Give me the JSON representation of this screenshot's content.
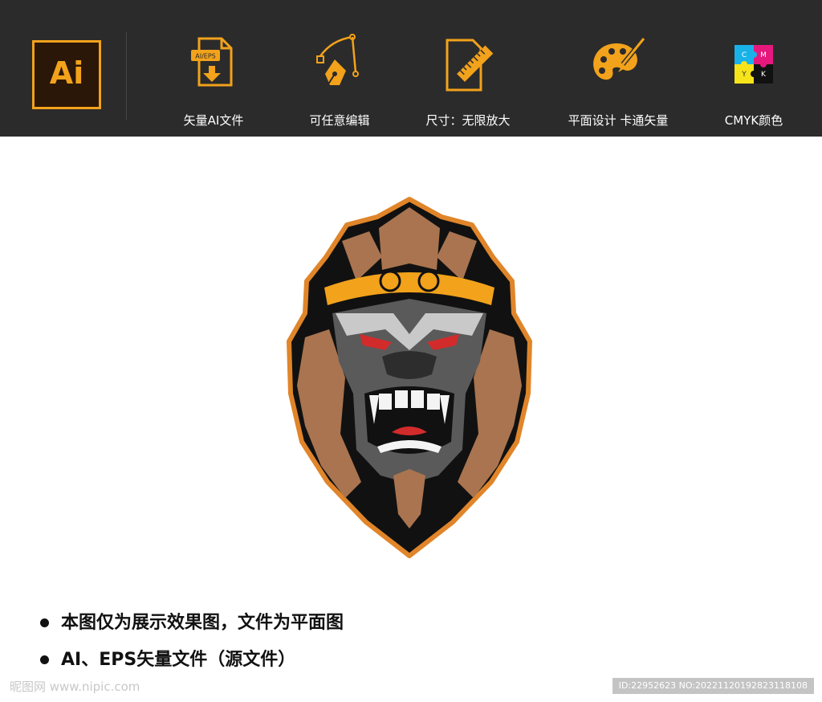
{
  "banner": {
    "logo_text": "Ai",
    "features": [
      {
        "icon": "file-download-icon",
        "badge": "AI/EPS",
        "label": "矢量AI文件"
      },
      {
        "icon": "pen-tool-icon",
        "label": "可任意编辑"
      },
      {
        "icon": "ruler-document-icon",
        "label": "尺寸：无限放大"
      },
      {
        "icon": "palette-brush-icon",
        "label": "平面设计  卡通矢量"
      },
      {
        "icon": "cmyk-puzzle-icon",
        "letters": [
          "C",
          "M",
          "Y",
          "K"
        ],
        "label": "CMYK颜色"
      }
    ]
  },
  "notes": [
    "本图仅为展示效果图，文件为平面图",
    "AI、EPS矢量文件（源文件）"
  ],
  "watermark": "昵图网 www.nipic.com",
  "id_tag": "ID:22952623 NO:20221120192823118108",
  "colors": {
    "accent": "#f2a21b",
    "banner_bg": "#2b2b2b",
    "mascot_outline": "#e0852a"
  }
}
